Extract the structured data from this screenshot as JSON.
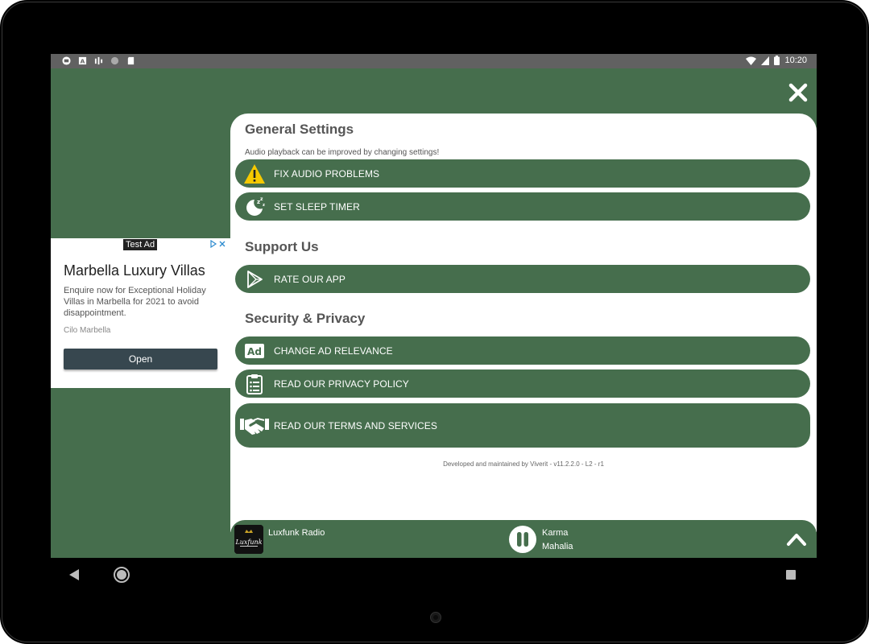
{
  "status_bar": {
    "time": "10:20",
    "left_icons": [
      "app-icon",
      "a-icon",
      "signal-bars-icon",
      "circle-icon",
      "sd-card-icon"
    ],
    "right_icons": [
      "wifi-icon",
      "cell-signal-icon",
      "battery-icon"
    ]
  },
  "ad": {
    "badge": "Test Ad",
    "title": "Marbella Luxury Villas",
    "description": "Enquire now for Exceptional Holiday Villas in Marbella for 2021 to avoid disappointment.",
    "advertiser": "Cilo Marbella",
    "cta": "Open",
    "choices_icon": "ad-choices-icon"
  },
  "settings": {
    "general": {
      "title": "General Settings",
      "description": "Audio playback can be improved by changing settings!",
      "fix_audio": "FIX AUDIO PROBLEMS",
      "sleep_timer": "SET SLEEP TIMER"
    },
    "support": {
      "title": "Support Us",
      "rate_app": "RATE OUR APP"
    },
    "security": {
      "title": "Security & Privacy",
      "ad_relevance": "CHANGE AD RELEVANCE",
      "privacy_policy": "READ OUR PRIVACY POLICY",
      "terms": "READ OUR TERMS AND SERVICES"
    },
    "footer": "Developed and maintained by Viverit - v11.2.2.0 - L2 - r1"
  },
  "player": {
    "station": "Luxfunk Radio",
    "logo_text": "Luxfunk",
    "track_title": "Karma",
    "track_artist": "Mahalia"
  },
  "colors": {
    "brand_green": "#466e4d",
    "panel_white": "#ffffff",
    "status_bar": "#616161",
    "warning_yellow": "#f6c900"
  }
}
